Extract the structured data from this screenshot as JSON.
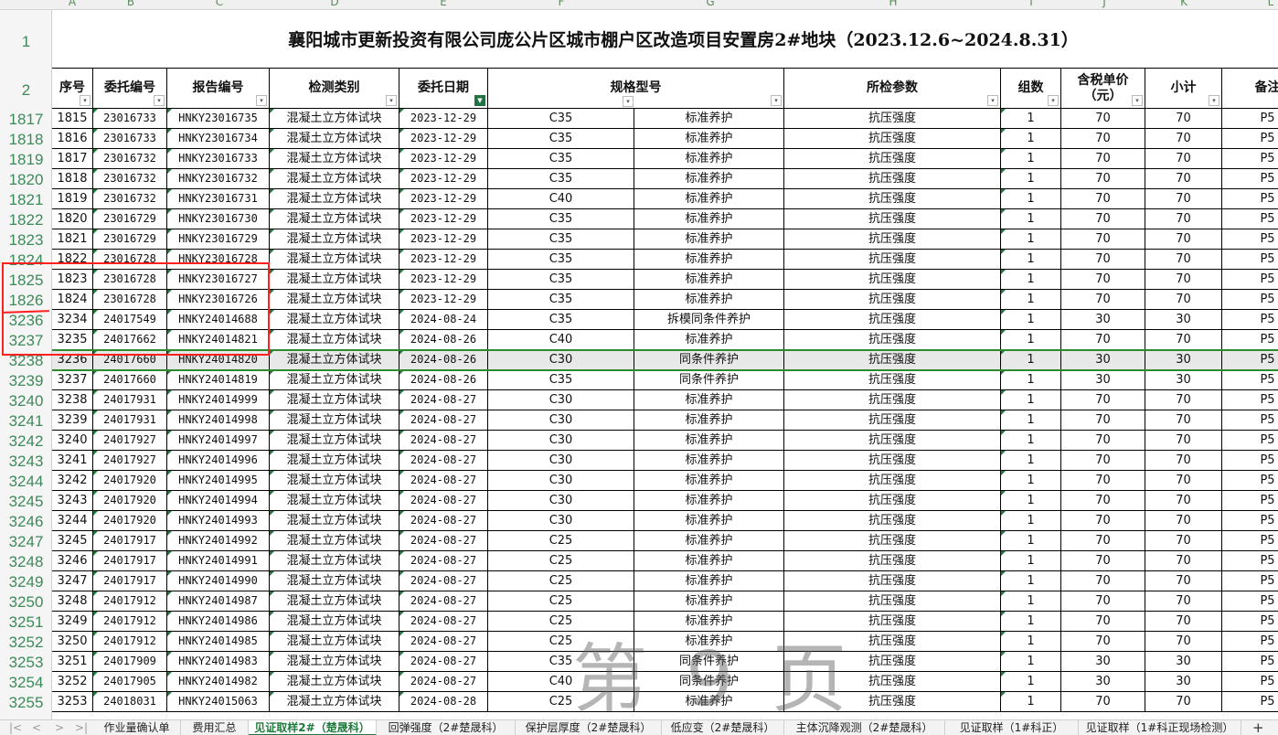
{
  "columns": [
    "A",
    "B",
    "C",
    "D",
    "E",
    "F",
    "G",
    "H",
    "I",
    "J",
    "K",
    "L"
  ],
  "title": "襄阳城市更新投资有限公司庞公片区城市棚户区改造项目安置房2#地块（2023.12.6~2024.8.31）",
  "row_labels_top": [
    "1",
    "2"
  ],
  "headers": [
    "序号",
    "委托编号",
    "报告编号",
    "检测类别",
    "委托日期",
    "规格型号",
    "所检参数",
    "组数",
    "含税单价（元）",
    "小计",
    "备注"
  ],
  "rows": [
    {
      "rn": "1817",
      "seq": "1815",
      "wt": "23016733",
      "bg": "HNKY23016735",
      "lb": "混凝土立方体试块",
      "dt": "2023-12-29",
      "gg": "C35",
      "yh": "标准养护",
      "cs": "抗压强度",
      "zs": "1",
      "dj": "70",
      "xj": "70",
      "bz": "P5"
    },
    {
      "rn": "1818",
      "seq": "1816",
      "wt": "23016733",
      "bg": "HNKY23016734",
      "lb": "混凝土立方体试块",
      "dt": "2023-12-29",
      "gg": "C35",
      "yh": "标准养护",
      "cs": "抗压强度",
      "zs": "1",
      "dj": "70",
      "xj": "70",
      "bz": "P5"
    },
    {
      "rn": "1819",
      "seq": "1817",
      "wt": "23016732",
      "bg": "HNKY23016733",
      "lb": "混凝土立方体试块",
      "dt": "2023-12-29",
      "gg": "C35",
      "yh": "标准养护",
      "cs": "抗压强度",
      "zs": "1",
      "dj": "70",
      "xj": "70",
      "bz": "P5"
    },
    {
      "rn": "1820",
      "seq": "1818",
      "wt": "23016732",
      "bg": "HNKY23016732",
      "lb": "混凝土立方体试块",
      "dt": "2023-12-29",
      "gg": "C35",
      "yh": "标准养护",
      "cs": "抗压强度",
      "zs": "1",
      "dj": "70",
      "xj": "70",
      "bz": "P5"
    },
    {
      "rn": "1821",
      "seq": "1819",
      "wt": "23016732",
      "bg": "HNKY23016731",
      "lb": "混凝土立方体试块",
      "dt": "2023-12-29",
      "gg": "C40",
      "yh": "标准养护",
      "cs": "抗压强度",
      "zs": "1",
      "dj": "70",
      "xj": "70",
      "bz": "P5"
    },
    {
      "rn": "1822",
      "seq": "1820",
      "wt": "23016729",
      "bg": "HNKY23016730",
      "lb": "混凝土立方体试块",
      "dt": "2023-12-29",
      "gg": "C35",
      "yh": "标准养护",
      "cs": "抗压强度",
      "zs": "1",
      "dj": "70",
      "xj": "70",
      "bz": "P5"
    },
    {
      "rn": "1823",
      "seq": "1821",
      "wt": "23016729",
      "bg": "HNKY23016729",
      "lb": "混凝土立方体试块",
      "dt": "2023-12-29",
      "gg": "C35",
      "yh": "标准养护",
      "cs": "抗压强度",
      "zs": "1",
      "dj": "70",
      "xj": "70",
      "bz": "P5"
    },
    {
      "rn": "1824",
      "seq": "1822",
      "wt": "23016728",
      "bg": "HNKY23016728",
      "lb": "混凝土立方体试块",
      "dt": "2023-12-29",
      "gg": "C35",
      "yh": "标准养护",
      "cs": "抗压强度",
      "zs": "1",
      "dj": "70",
      "xj": "70",
      "bz": "P5"
    },
    {
      "rn": "1825",
      "seq": "1823",
      "wt": "23016728",
      "bg": "HNKY23016727",
      "lb": "混凝土立方体试块",
      "dt": "2023-12-29",
      "gg": "C35",
      "yh": "标准养护",
      "cs": "抗压强度",
      "zs": "1",
      "dj": "70",
      "xj": "70",
      "bz": "P5"
    },
    {
      "rn": "1826",
      "seq": "1824",
      "wt": "23016728",
      "bg": "HNKY23016726",
      "lb": "混凝土立方体试块",
      "dt": "2023-12-29",
      "gg": "C35",
      "yh": "标准养护",
      "cs": "抗压强度",
      "zs": "1",
      "dj": "70",
      "xj": "70",
      "bz": "P5"
    },
    {
      "rn": "3236",
      "seq": "3234",
      "wt": "24017549",
      "bg": "HNKY24014688",
      "lb": "混凝土立方体试块",
      "dt": "2024-08-24",
      "gg": "C35",
      "yh": "拆模同条件养护",
      "cs": "抗压强度",
      "zs": "1",
      "dj": "30",
      "xj": "30",
      "bz": "P5"
    },
    {
      "rn": "3237",
      "seq": "3235",
      "wt": "24017662",
      "bg": "HNKY24014821",
      "lb": "混凝土立方体试块",
      "dt": "2024-08-26",
      "gg": "C40",
      "yh": "标准养护",
      "cs": "抗压强度",
      "zs": "1",
      "dj": "70",
      "xj": "70",
      "bz": "P5"
    },
    {
      "rn": "3238",
      "seq": "3236",
      "wt": "24017660",
      "bg": "HNKY24014820",
      "lb": "混凝土立方体试块",
      "dt": "2024-08-26",
      "gg": "C30",
      "yh": "同条件养护",
      "cs": "抗压强度",
      "zs": "1",
      "dj": "30",
      "xj": "30",
      "bz": "P5"
    },
    {
      "rn": "3239",
      "seq": "3237",
      "wt": "24017660",
      "bg": "HNKY24014819",
      "lb": "混凝土立方体试块",
      "dt": "2024-08-26",
      "gg": "C35",
      "yh": "同条件养护",
      "cs": "抗压强度",
      "zs": "1",
      "dj": "30",
      "xj": "30",
      "bz": "P5"
    },
    {
      "rn": "3240",
      "seq": "3238",
      "wt": "24017931",
      "bg": "HNKY24014999",
      "lb": "混凝土立方体试块",
      "dt": "2024-08-27",
      "gg": "C30",
      "yh": "标准养护",
      "cs": "抗压强度",
      "zs": "1",
      "dj": "70",
      "xj": "70",
      "bz": "P5"
    },
    {
      "rn": "3241",
      "seq": "3239",
      "wt": "24017931",
      "bg": "HNKY24014998",
      "lb": "混凝土立方体试块",
      "dt": "2024-08-27",
      "gg": "C30",
      "yh": "标准养护",
      "cs": "抗压强度",
      "zs": "1",
      "dj": "70",
      "xj": "70",
      "bz": "P5"
    },
    {
      "rn": "3242",
      "seq": "3240",
      "wt": "24017927",
      "bg": "HNKY24014997",
      "lb": "混凝土立方体试块",
      "dt": "2024-08-27",
      "gg": "C30",
      "yh": "标准养护",
      "cs": "抗压强度",
      "zs": "1",
      "dj": "70",
      "xj": "70",
      "bz": "P5"
    },
    {
      "rn": "3243",
      "seq": "3241",
      "wt": "24017927",
      "bg": "HNKY24014996",
      "lb": "混凝土立方体试块",
      "dt": "2024-08-27",
      "gg": "C30",
      "yh": "标准养护",
      "cs": "抗压强度",
      "zs": "1",
      "dj": "70",
      "xj": "70",
      "bz": "P5"
    },
    {
      "rn": "3244",
      "seq": "3242",
      "wt": "24017920",
      "bg": "HNKY24014995",
      "lb": "混凝土立方体试块",
      "dt": "2024-08-27",
      "gg": "C30",
      "yh": "标准养护",
      "cs": "抗压强度",
      "zs": "1",
      "dj": "70",
      "xj": "70",
      "bz": "P5"
    },
    {
      "rn": "3245",
      "seq": "3243",
      "wt": "24017920",
      "bg": "HNKY24014994",
      "lb": "混凝土立方体试块",
      "dt": "2024-08-27",
      "gg": "C30",
      "yh": "标准养护",
      "cs": "抗压强度",
      "zs": "1",
      "dj": "70",
      "xj": "70",
      "bz": "P5"
    },
    {
      "rn": "3246",
      "seq": "3244",
      "wt": "24017920",
      "bg": "HNKY24014993",
      "lb": "混凝土立方体试块",
      "dt": "2024-08-27",
      "gg": "C30",
      "yh": "标准养护",
      "cs": "抗压强度",
      "zs": "1",
      "dj": "70",
      "xj": "70",
      "bz": "P5"
    },
    {
      "rn": "3247",
      "seq": "3245",
      "wt": "24017917",
      "bg": "HNKY24014992",
      "lb": "混凝土立方体试块",
      "dt": "2024-08-27",
      "gg": "C25",
      "yh": "标准养护",
      "cs": "抗压强度",
      "zs": "1",
      "dj": "70",
      "xj": "70",
      "bz": "P5"
    },
    {
      "rn": "3248",
      "seq": "3246",
      "wt": "24017917",
      "bg": "HNKY24014991",
      "lb": "混凝土立方体试块",
      "dt": "2024-08-27",
      "gg": "C25",
      "yh": "标准养护",
      "cs": "抗压强度",
      "zs": "1",
      "dj": "70",
      "xj": "70",
      "bz": "P5"
    },
    {
      "rn": "3249",
      "seq": "3247",
      "wt": "24017917",
      "bg": "HNKY24014990",
      "lb": "混凝土立方体试块",
      "dt": "2024-08-27",
      "gg": "C25",
      "yh": "标准养护",
      "cs": "抗压强度",
      "zs": "1",
      "dj": "70",
      "xj": "70",
      "bz": "P5"
    },
    {
      "rn": "3250",
      "seq": "3248",
      "wt": "24017912",
      "bg": "HNKY24014987",
      "lb": "混凝土立方体试块",
      "dt": "2024-08-27",
      "gg": "C25",
      "yh": "标准养护",
      "cs": "抗压强度",
      "zs": "1",
      "dj": "70",
      "xj": "70",
      "bz": "P5"
    },
    {
      "rn": "3251",
      "seq": "3249",
      "wt": "24017912",
      "bg": "HNKY24014986",
      "lb": "混凝土立方体试块",
      "dt": "2024-08-27",
      "gg": "C25",
      "yh": "标准养护",
      "cs": "抗压强度",
      "zs": "1",
      "dj": "70",
      "xj": "70",
      "bz": "P5"
    },
    {
      "rn": "3252",
      "seq": "3250",
      "wt": "24017912",
      "bg": "HNKY24014985",
      "lb": "混凝土立方体试块",
      "dt": "2024-08-27",
      "gg": "C25",
      "yh": "标准养护",
      "cs": "抗压强度",
      "zs": "1",
      "dj": "70",
      "xj": "70",
      "bz": "P5"
    },
    {
      "rn": "3253",
      "seq": "3251",
      "wt": "24017909",
      "bg": "HNKY24014983",
      "lb": "混凝土立方体试块",
      "dt": "2024-08-27",
      "gg": "C35",
      "yh": "同条件养护",
      "cs": "抗压强度",
      "zs": "1",
      "dj": "30",
      "xj": "30",
      "bz": "P5"
    },
    {
      "rn": "3254",
      "seq": "3252",
      "wt": "24017905",
      "bg": "HNKY24014982",
      "lb": "混凝土立方体试块",
      "dt": "2024-08-27",
      "gg": "C40",
      "yh": "同条件养护",
      "cs": "抗压强度",
      "zs": "1",
      "dj": "30",
      "xj": "30",
      "bz": "P5"
    },
    {
      "rn": "3255",
      "seq": "3253",
      "wt": "24018031",
      "bg": "HNKY24015063",
      "lb": "混凝土立方体试块",
      "dt": "2024-08-28",
      "gg": "C25",
      "yh": "标准养护",
      "cs": "抗压强度",
      "zs": "1",
      "dj": "70",
      "xj": "70",
      "bz": "P5"
    }
  ],
  "watermark": "第 9 页",
  "sheet_nav": [
    "|<",
    "<",
    ">",
    ">|"
  ],
  "sheet_tabs": [
    {
      "label": "作业量确认单",
      "active": false
    },
    {
      "label": "费用汇总",
      "active": false
    },
    {
      "label": "见证取样2#（楚晟科）",
      "active": true
    },
    {
      "label": "回弹强度（2#楚晟科）",
      "active": false
    },
    {
      "label": "保护层厚度（2#楚晟科）",
      "active": false
    },
    {
      "label": "低应变（2#楚晟科）",
      "active": false
    },
    {
      "label": "主体沉降观测（2#楚晟科）",
      "active": false
    },
    {
      "label": "见证取样（1#科正）",
      "active": false
    },
    {
      "label": "见证取样（1#科正现场检测）",
      "active": false
    }
  ],
  "add_sheet": "+",
  "colors": {
    "accent": "#1e7a3c",
    "highlight": "#ff2020",
    "row_label": "#3d8a5a"
  }
}
